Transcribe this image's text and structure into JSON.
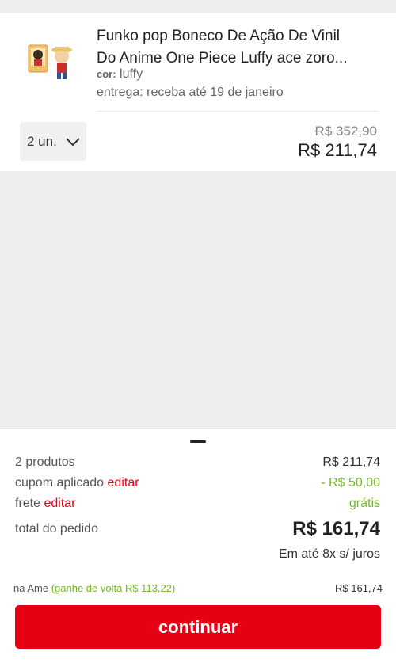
{
  "product": {
    "title_line1": "Funko pop Boneco De Ação De Vinil",
    "title_line2": "Do Anime One Piece Luffy ace zoro...",
    "color_label": "cor:",
    "color_value": " luffy",
    "delivery": "entrega: receba até 19 de janeiro",
    "quantity": "2 un.",
    "old_price": "R$ 352,90",
    "price": "R$ 211,74"
  },
  "summary": {
    "products_label": "2 produtos",
    "products_value": "R$ 211,74",
    "coupon_label": "cupom aplicado",
    "coupon_edit": "editar",
    "coupon_value": "- R$ 50,00",
    "shipping_label": "frete",
    "shipping_edit": "editar",
    "shipping_value": "grátis",
    "total_label": "total do pedido",
    "total_value": "R$ 161,74",
    "installments": "Em até 8x s/ juros",
    "ame_label": "na Ame",
    "ame_cashback": "(ganhe de volta R$ 113,22)",
    "ame_value": "R$ 161,74",
    "continue_label": "continuar"
  },
  "colors": {
    "accent_red": "#e60014",
    "green": "#76b82a",
    "background": "#ededed"
  },
  "icons": {
    "quantity": "chevron-down-icon",
    "thumbnail": "funko-figure-image"
  }
}
